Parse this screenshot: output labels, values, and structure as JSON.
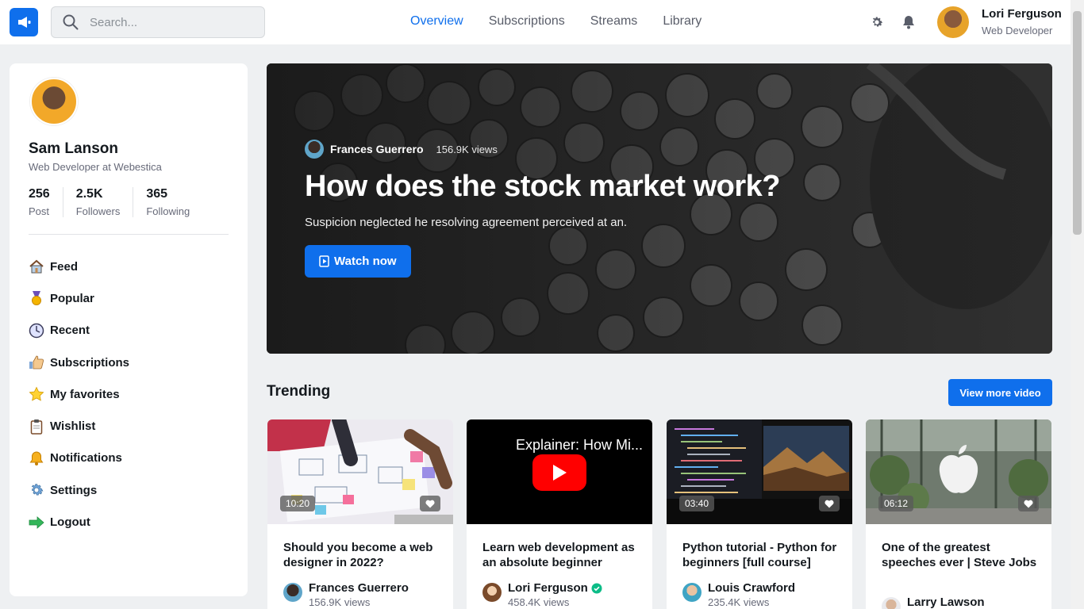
{
  "header": {
    "search_placeholder": "Search...",
    "nav": [
      "Overview",
      "Subscriptions",
      "Streams",
      "Library"
    ],
    "user_name": "Lori Ferguson",
    "user_role": "Web Developer",
    "accent": "#0f6fec"
  },
  "sidebar": {
    "name": "Sam Lanson",
    "role": "Web Developer at Webestica",
    "stats": [
      {
        "num": "256",
        "label": "Post"
      },
      {
        "num": "2.5K",
        "label": "Followers"
      },
      {
        "num": "365",
        "label": "Following"
      }
    ],
    "menu": [
      {
        "label": "Feed",
        "icon": "home-icon"
      },
      {
        "label": "Popular",
        "icon": "medal-icon"
      },
      {
        "label": "Recent",
        "icon": "clock-icon"
      },
      {
        "label": "Subscriptions",
        "icon": "thumbs-up-icon"
      },
      {
        "label": "My favorites",
        "icon": "star-icon"
      },
      {
        "label": "Wishlist",
        "icon": "clipboard-icon"
      },
      {
        "label": "Notifications",
        "icon": "bell-icon"
      },
      {
        "label": "Settings",
        "icon": "gear-icon"
      },
      {
        "label": "Logout",
        "icon": "arrow-right-icon"
      }
    ]
  },
  "hero": {
    "author": "Frances Guerrero",
    "views": "156.9K views",
    "title": "How does the stock market work?",
    "subtitle": "Suspicion neglected he resolving agreement perceived at an.",
    "button": "Watch now"
  },
  "trending": {
    "title": "Trending",
    "more_button": "View more video",
    "cards": [
      {
        "duration": "10:20",
        "title": "Should you become a web designer in 2022?",
        "author": "Frances Guerrero",
        "views": "156.9K views",
        "verified": false
      },
      {
        "duration": "",
        "video_title": "Explainer: How Mi...",
        "title": "Learn web development as an absolute beginner",
        "author": "Lori Ferguson",
        "views": "458.4K views",
        "verified": true
      },
      {
        "duration": "03:40",
        "title": "Python tutorial - Python for beginners [full course]",
        "author": "Louis Crawford",
        "views": "235.4K views",
        "verified": false
      },
      {
        "duration": "06:12",
        "title": "One of the greatest speeches ever | Steve Jobs",
        "author": "Larry Lawson",
        "views": "",
        "verified": false
      }
    ]
  }
}
